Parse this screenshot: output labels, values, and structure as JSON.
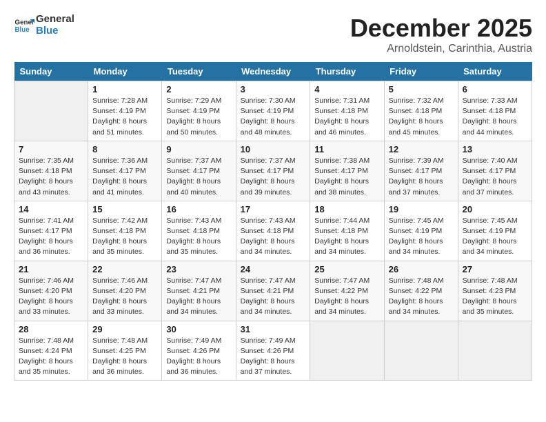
{
  "logo": {
    "general": "General",
    "blue": "Blue"
  },
  "header": {
    "month": "December 2025",
    "location": "Arnoldstein, Carinthia, Austria"
  },
  "weekdays": [
    "Sunday",
    "Monday",
    "Tuesday",
    "Wednesday",
    "Thursday",
    "Friday",
    "Saturday"
  ],
  "weeks": [
    [
      {
        "day": "",
        "info": ""
      },
      {
        "day": "1",
        "info": "Sunrise: 7:28 AM\nSunset: 4:19 PM\nDaylight: 8 hours\nand 51 minutes."
      },
      {
        "day": "2",
        "info": "Sunrise: 7:29 AM\nSunset: 4:19 PM\nDaylight: 8 hours\nand 50 minutes."
      },
      {
        "day": "3",
        "info": "Sunrise: 7:30 AM\nSunset: 4:19 PM\nDaylight: 8 hours\nand 48 minutes."
      },
      {
        "day": "4",
        "info": "Sunrise: 7:31 AM\nSunset: 4:18 PM\nDaylight: 8 hours\nand 46 minutes."
      },
      {
        "day": "5",
        "info": "Sunrise: 7:32 AM\nSunset: 4:18 PM\nDaylight: 8 hours\nand 45 minutes."
      },
      {
        "day": "6",
        "info": "Sunrise: 7:33 AM\nSunset: 4:18 PM\nDaylight: 8 hours\nand 44 minutes."
      }
    ],
    [
      {
        "day": "7",
        "info": "Sunrise: 7:35 AM\nSunset: 4:18 PM\nDaylight: 8 hours\nand 43 minutes."
      },
      {
        "day": "8",
        "info": "Sunrise: 7:36 AM\nSunset: 4:17 PM\nDaylight: 8 hours\nand 41 minutes."
      },
      {
        "day": "9",
        "info": "Sunrise: 7:37 AM\nSunset: 4:17 PM\nDaylight: 8 hours\nand 40 minutes."
      },
      {
        "day": "10",
        "info": "Sunrise: 7:37 AM\nSunset: 4:17 PM\nDaylight: 8 hours\nand 39 minutes."
      },
      {
        "day": "11",
        "info": "Sunrise: 7:38 AM\nSunset: 4:17 PM\nDaylight: 8 hours\nand 38 minutes."
      },
      {
        "day": "12",
        "info": "Sunrise: 7:39 AM\nSunset: 4:17 PM\nDaylight: 8 hours\nand 37 minutes."
      },
      {
        "day": "13",
        "info": "Sunrise: 7:40 AM\nSunset: 4:17 PM\nDaylight: 8 hours\nand 37 minutes."
      }
    ],
    [
      {
        "day": "14",
        "info": "Sunrise: 7:41 AM\nSunset: 4:17 PM\nDaylight: 8 hours\nand 36 minutes."
      },
      {
        "day": "15",
        "info": "Sunrise: 7:42 AM\nSunset: 4:18 PM\nDaylight: 8 hours\nand 35 minutes."
      },
      {
        "day": "16",
        "info": "Sunrise: 7:43 AM\nSunset: 4:18 PM\nDaylight: 8 hours\nand 35 minutes."
      },
      {
        "day": "17",
        "info": "Sunrise: 7:43 AM\nSunset: 4:18 PM\nDaylight: 8 hours\nand 34 minutes."
      },
      {
        "day": "18",
        "info": "Sunrise: 7:44 AM\nSunset: 4:18 PM\nDaylight: 8 hours\nand 34 minutes."
      },
      {
        "day": "19",
        "info": "Sunrise: 7:45 AM\nSunset: 4:19 PM\nDaylight: 8 hours\nand 34 minutes."
      },
      {
        "day": "20",
        "info": "Sunrise: 7:45 AM\nSunset: 4:19 PM\nDaylight: 8 hours\nand 34 minutes."
      }
    ],
    [
      {
        "day": "21",
        "info": "Sunrise: 7:46 AM\nSunset: 4:20 PM\nDaylight: 8 hours\nand 33 minutes."
      },
      {
        "day": "22",
        "info": "Sunrise: 7:46 AM\nSunset: 4:20 PM\nDaylight: 8 hours\nand 33 minutes."
      },
      {
        "day": "23",
        "info": "Sunrise: 7:47 AM\nSunset: 4:21 PM\nDaylight: 8 hours\nand 34 minutes."
      },
      {
        "day": "24",
        "info": "Sunrise: 7:47 AM\nSunset: 4:21 PM\nDaylight: 8 hours\nand 34 minutes."
      },
      {
        "day": "25",
        "info": "Sunrise: 7:47 AM\nSunset: 4:22 PM\nDaylight: 8 hours\nand 34 minutes."
      },
      {
        "day": "26",
        "info": "Sunrise: 7:48 AM\nSunset: 4:22 PM\nDaylight: 8 hours\nand 34 minutes."
      },
      {
        "day": "27",
        "info": "Sunrise: 7:48 AM\nSunset: 4:23 PM\nDaylight: 8 hours\nand 35 minutes."
      }
    ],
    [
      {
        "day": "28",
        "info": "Sunrise: 7:48 AM\nSunset: 4:24 PM\nDaylight: 8 hours\nand 35 minutes."
      },
      {
        "day": "29",
        "info": "Sunrise: 7:48 AM\nSunset: 4:25 PM\nDaylight: 8 hours\nand 36 minutes."
      },
      {
        "day": "30",
        "info": "Sunrise: 7:49 AM\nSunset: 4:26 PM\nDaylight: 8 hours\nand 36 minutes."
      },
      {
        "day": "31",
        "info": "Sunrise: 7:49 AM\nSunset: 4:26 PM\nDaylight: 8 hours\nand 37 minutes."
      },
      {
        "day": "",
        "info": ""
      },
      {
        "day": "",
        "info": ""
      },
      {
        "day": "",
        "info": ""
      }
    ]
  ]
}
